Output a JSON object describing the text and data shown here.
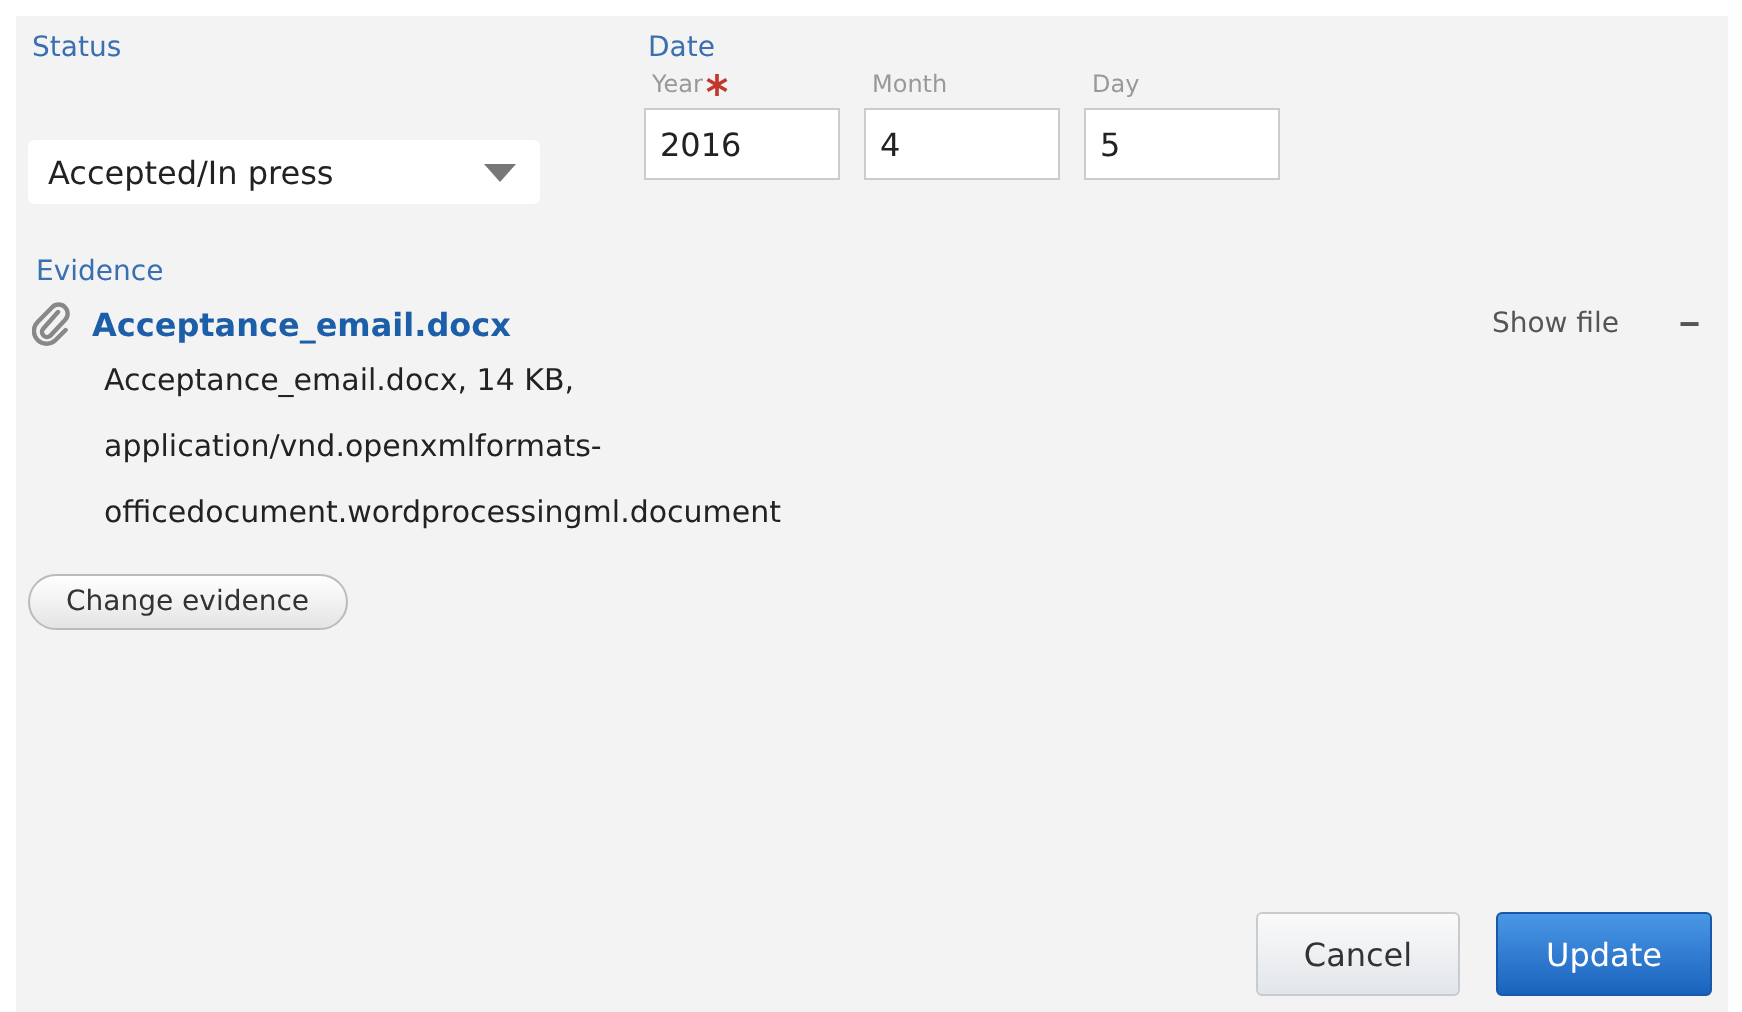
{
  "status": {
    "label": "Status",
    "value": "Accepted/In press"
  },
  "date": {
    "label": "Date",
    "fields": [
      {
        "label": "Year",
        "required": true,
        "value": "2016"
      },
      {
        "label": "Month",
        "required": false,
        "value": "4"
      },
      {
        "label": "Day",
        "required": false,
        "value": "5"
      }
    ]
  },
  "evidence": {
    "label": "Evidence",
    "file_name": "Acceptance_email.docx",
    "show_file": "Show file",
    "remove": "−",
    "details": [
      "Acceptance_email.docx, 14 KB,",
      "application/vnd.openxmlformats-",
      "officedocument.wordprocessingml.document"
    ],
    "change_button": "Change evidence"
  },
  "buttons": [
    {
      "label": "Cancel",
      "kind": "secondary"
    },
    {
      "label": "Update",
      "kind": "primary"
    }
  ]
}
